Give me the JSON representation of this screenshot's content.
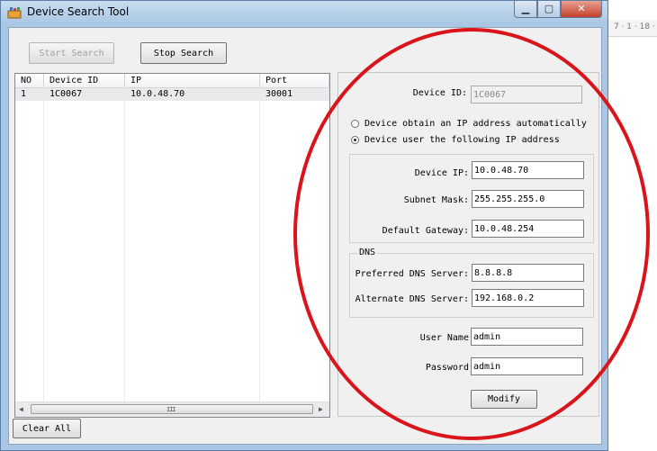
{
  "window": {
    "title": "Device Search Tool"
  },
  "background": {
    "ruler_text": "7 · 1 · 18 ·"
  },
  "toolbar": {
    "start_label": "Start Search",
    "stop_label": "Stop Search"
  },
  "list": {
    "columns": [
      "NO",
      "Device ID",
      "IP",
      "Port"
    ],
    "rows": [
      {
        "no": "1",
        "device_id": "1C0067",
        "ip": "10.0.48.70",
        "port": "30001"
      }
    ],
    "scroll_grip": "III"
  },
  "device_panel": {
    "device_id_label": "Device ID:",
    "device_id_value": "1C0067",
    "radio_auto_label": "Device obtain an IP address automatically",
    "radio_manual_label": "Device user the following IP address",
    "device_ip_label": "Device IP:",
    "device_ip_value": "10.0.48.70",
    "subnet_label": "Subnet Mask:",
    "subnet_value": "255.255.255.0",
    "gateway_label": "Default Gateway:",
    "gateway_value": "10.0.48.254",
    "dns_group_title": "DNS",
    "preferred_dns_label": "Preferred DNS Server:",
    "preferred_dns_value": "8.8.8.8",
    "alternate_dns_label": "Alternate DNS Server:",
    "alternate_dns_value": "192.168.0.2",
    "username_label": "User Name:",
    "username_value": "admin",
    "password_label": "Password:",
    "password_value": "admin",
    "modify_label": "Modify"
  },
  "footer": {
    "clear_label": "Clear All"
  },
  "colors": {
    "annotation": "#d9141b",
    "titlebar": "#a9c6e4",
    "client": "#f0f0f0"
  }
}
